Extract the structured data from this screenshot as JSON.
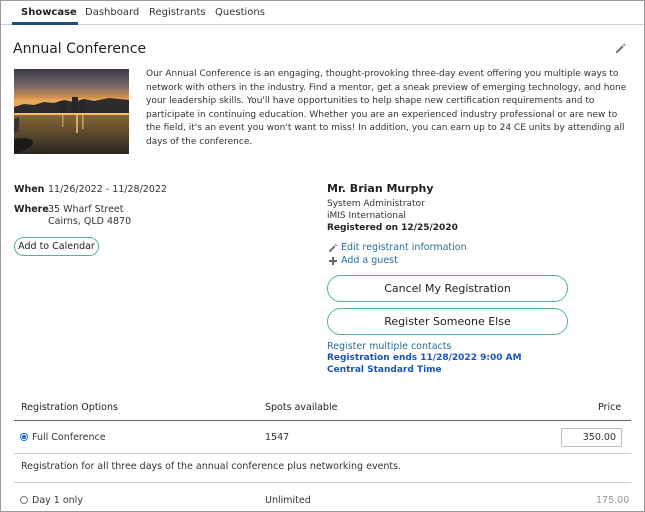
{
  "tabs": [
    {
      "label": "Showcase"
    },
    {
      "label": "Dashboard"
    },
    {
      "label": "Registrants"
    },
    {
      "label": "Questions"
    }
  ],
  "event": {
    "title": "Annual Conference",
    "description": "Our Annual Conference is an engaging, thought-provoking three-day event offering you multiple ways to network with others in the industry. Find a mentor, get a sneak preview of emerging technology, and hone your leadership skills. You'll have opportunities to help shape new certification requirements and to participate in continuing education. Whether you are an experienced industry professional or are new to the field, it's an event you won't want to miss! In addition, you can earn up to 24 CE units by attending all days of the conference.",
    "when_label": "When",
    "when_value": "11/26/2022 - 11/28/2022",
    "where_label": "Where",
    "where_line1": "35 Wharf Street",
    "where_line2": "Cairns, QLD 4870",
    "add_calendar": "Add to Calendar"
  },
  "registrant": {
    "name": "Mr. Brian Murphy",
    "title": "System Administrator",
    "org": "iMIS International",
    "registered": "Registered on 12/25/2020",
    "edit_link": "Edit registrant information",
    "guest_link": "Add a guest",
    "cancel_button": "Cancel My Registration",
    "register_else_button": "Register Someone Else",
    "multiple_link": "Register multiple contacts",
    "ends_line1": "Registration ends 11/28/2022 9:00 AM",
    "ends_line2": "Central Standard Time"
  },
  "options_table": {
    "headers": {
      "option": "Registration Options",
      "spots": "Spots available",
      "price": "Price"
    },
    "rows": [
      {
        "name": "Full Conference",
        "spots": "1547",
        "price": "350.00",
        "selected": true,
        "note": "Registration for all three days of the annual conference plus networking events."
      },
      {
        "name": "Day 1 only",
        "spots": "Unlimited",
        "price": "175.00",
        "selected": false
      }
    ]
  },
  "colors": {
    "accent_teal": "#55b59a",
    "link_blue": "#2a6d96",
    "emphasis_blue": "#1a55b0",
    "tab_underline": "#1f4e79"
  },
  "icons": [
    "edit-pencil-icon",
    "pencil-icon",
    "plus-icon"
  ]
}
